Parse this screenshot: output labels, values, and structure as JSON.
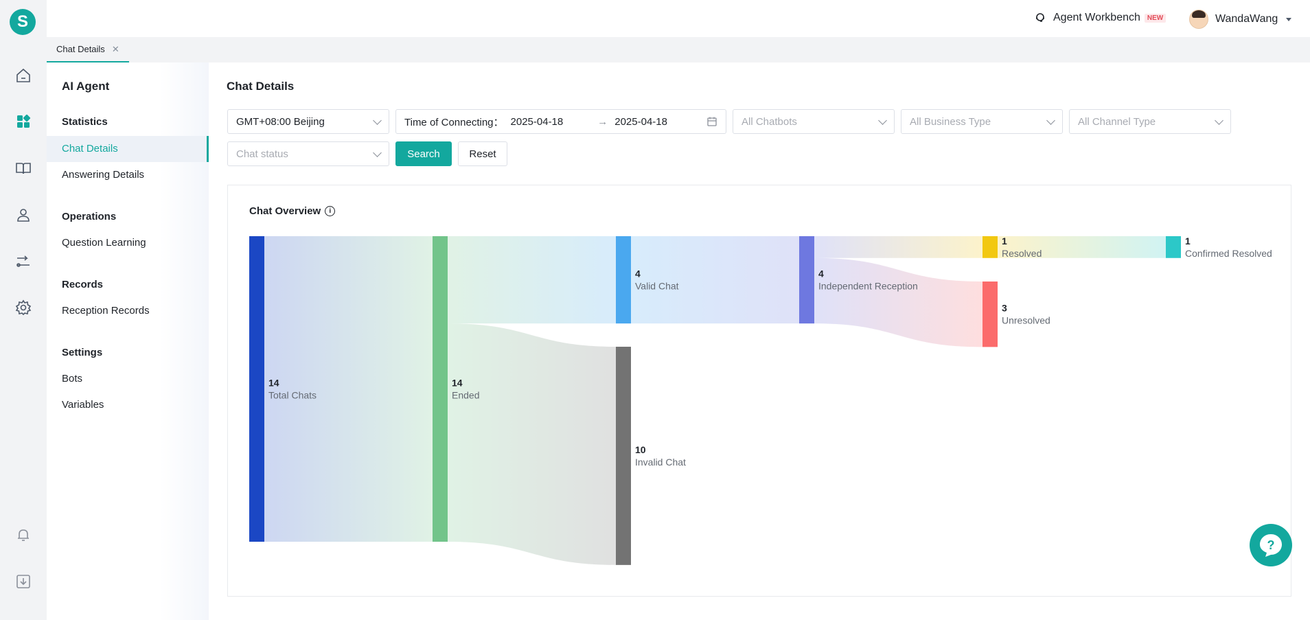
{
  "header": {
    "workbench_label": "Agent Workbench",
    "workbench_badge": "NEW",
    "user_name": "WandaWang"
  },
  "tabs": [
    {
      "label": "Chat Details"
    }
  ],
  "sidebar": {
    "title": "AI Agent",
    "sections": [
      {
        "title": "Statistics",
        "items": [
          "Chat Details",
          "Answering Details"
        ]
      },
      {
        "title": "Operations",
        "items": [
          "Question Learning"
        ]
      },
      {
        "title": "Records",
        "items": [
          "Reception Records"
        ]
      },
      {
        "title": "Settings",
        "items": [
          "Bots",
          "Variables"
        ]
      }
    ],
    "active_item": "Chat Details"
  },
  "main": {
    "title": "Chat Details",
    "filters": {
      "timezone": "GMT+08:00 Beijing",
      "time_label": "Time of Connecting：",
      "date_start": "2025-04-18",
      "date_sep": "→",
      "date_end": "2025-04-18",
      "chatbots_placeholder": "All Chatbots",
      "business_placeholder": "All Business Type",
      "channel_placeholder": "All Channel Type",
      "status_placeholder": "Chat status",
      "search_label": "Search",
      "reset_label": "Reset"
    },
    "overview_title": "Chat Overview"
  },
  "chart_data": {
    "type": "sankey",
    "nodes": [
      {
        "id": "total",
        "label": "Total Chats",
        "value": 14,
        "color": "#1b47c4"
      },
      {
        "id": "ended",
        "label": "Ended",
        "value": 14,
        "color": "#72c48a"
      },
      {
        "id": "valid",
        "label": "Valid Chat",
        "value": 4,
        "color": "#4aa8ef"
      },
      {
        "id": "invalid",
        "label": "Invalid Chat",
        "value": 10,
        "color": "#737373"
      },
      {
        "id": "independent",
        "label": "Independent Reception",
        "value": 4,
        "color": "#6e78e0"
      },
      {
        "id": "resolved",
        "label": "Resolved",
        "value": 1,
        "color": "#f2c811"
      },
      {
        "id": "unresolved",
        "label": "Unresolved",
        "value": 3,
        "color": "#fb6b6b"
      },
      {
        "id": "confirmed",
        "label": "Confirmed Resolved",
        "value": 1,
        "color": "#2cc8c8"
      }
    ],
    "links": [
      {
        "source": "total",
        "target": "ended",
        "value": 14
      },
      {
        "source": "ended",
        "target": "valid",
        "value": 4
      },
      {
        "source": "ended",
        "target": "invalid",
        "value": 10
      },
      {
        "source": "valid",
        "target": "independent",
        "value": 4
      },
      {
        "source": "independent",
        "target": "resolved",
        "value": 1
      },
      {
        "source": "independent",
        "target": "unresolved",
        "value": 3
      },
      {
        "source": "resolved",
        "target": "confirmed",
        "value": 1
      }
    ]
  }
}
